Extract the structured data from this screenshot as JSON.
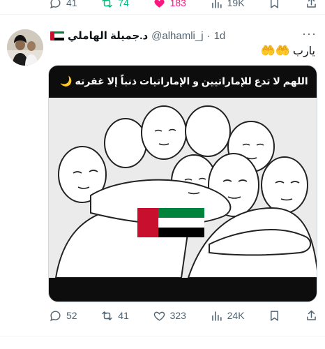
{
  "top_actions": {
    "replies": "41",
    "retweets": "74",
    "likes": "183",
    "views": "19K"
  },
  "tweet": {
    "display_name": "د.جميلة الهاملي",
    "handle": "@alhamli_j",
    "separator": "·",
    "time": "1d",
    "text": "يارب",
    "text_emoji": "🤲🤲",
    "media_caption": "اللهم لا تدع للإماراتيين و الإماراتيات ذنباً إلا غفرته",
    "media_caption_emoji": "🌙"
  },
  "bottom_actions": {
    "replies": "52",
    "retweets": "41",
    "likes": "323",
    "views": "24K"
  },
  "colors": {
    "retweet_active": "#00ba7c",
    "like_active": "#f91880",
    "muted": "#536471",
    "flag_red": "#c8102e",
    "flag_green": "#00843d",
    "flag_white": "#ffffff",
    "flag_black": "#000000"
  },
  "icons": {
    "reply": "reply-icon",
    "retweet": "retweet-icon",
    "like": "heart-icon",
    "views": "views-icon",
    "bookmark": "bookmark-icon",
    "share": "share-icon",
    "more": "more-icon",
    "flag": "uae-flag-icon",
    "moon": "crescent-moon-icon"
  }
}
